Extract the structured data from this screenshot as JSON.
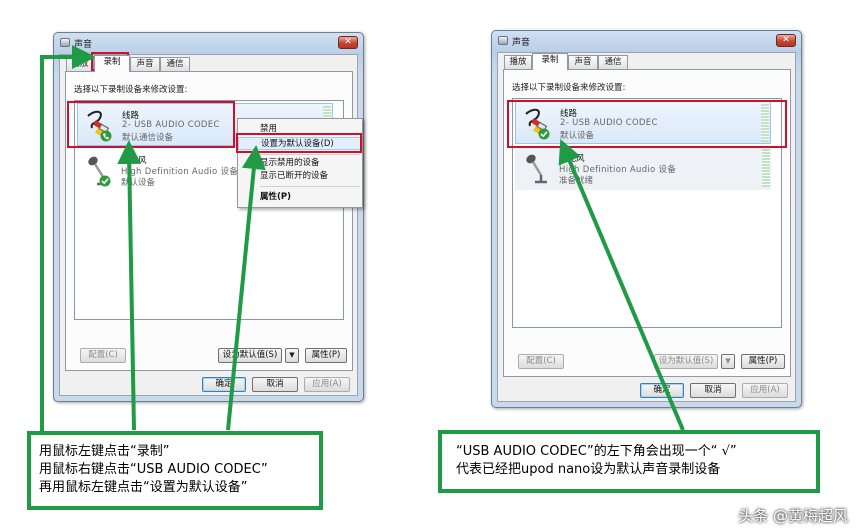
{
  "left_window": {
    "title": "声音",
    "close": "✕",
    "tabs": [
      "播放",
      "录制",
      "声音",
      "通信"
    ],
    "instruction": "选择以下录制设备来修改设置:",
    "devices": [
      {
        "name": "线路",
        "sub": "2- USB AUDIO  CODEC",
        "status": "默认通信设备"
      },
      {
        "name": "麦克风",
        "sub": "High Definition Audio 设备",
        "status": "默认设备"
      }
    ],
    "context_menu": {
      "items": [
        "禁用",
        "设置为默认设备(D)",
        "显示禁用的设备",
        "显示已断开的设备",
        "属性(P)"
      ]
    },
    "buttons": {
      "configure": "配置(C)",
      "set_default": "设为默认值(S)",
      "dropdown": "▼",
      "properties": "属性(P)",
      "ok": "确定",
      "cancel": "取消",
      "apply": "应用(A)"
    }
  },
  "right_window": {
    "title": "声音",
    "close": "✕",
    "tabs": [
      "播放",
      "录制",
      "声音",
      "通信"
    ],
    "instruction": "选择以下录制设备来修改设置:",
    "devices": [
      {
        "name": "线路",
        "sub": "2- USB AUDIO  CODEC",
        "status": "默认设备"
      },
      {
        "name": "麦克风",
        "sub": "High Definition Audio 设备",
        "status": "准备就绪"
      }
    ],
    "buttons": {
      "configure": "配置(C)",
      "set_default": "设为默认值(S)",
      "dropdown": "▼",
      "properties": "属性(P)",
      "ok": "确定",
      "cancel": "取消",
      "apply": "应用(A)"
    }
  },
  "notes": {
    "left": [
      "用鼠标左键点击“录制”",
      "用鼠标右键点击“USB AUDIO CODEC”",
      "再用鼠标左键点击“设置为默认设备”"
    ],
    "right": [
      "“USB AUDIO CODEC”的左下角会出现一个“ √”",
      "代表已经把upod nano设为默认声音录制设备"
    ]
  },
  "watermark": "头条 @黄梅超风",
  "colors": {
    "annotation_green": "#1f9a45",
    "highlight_red": "#d0102a"
  }
}
